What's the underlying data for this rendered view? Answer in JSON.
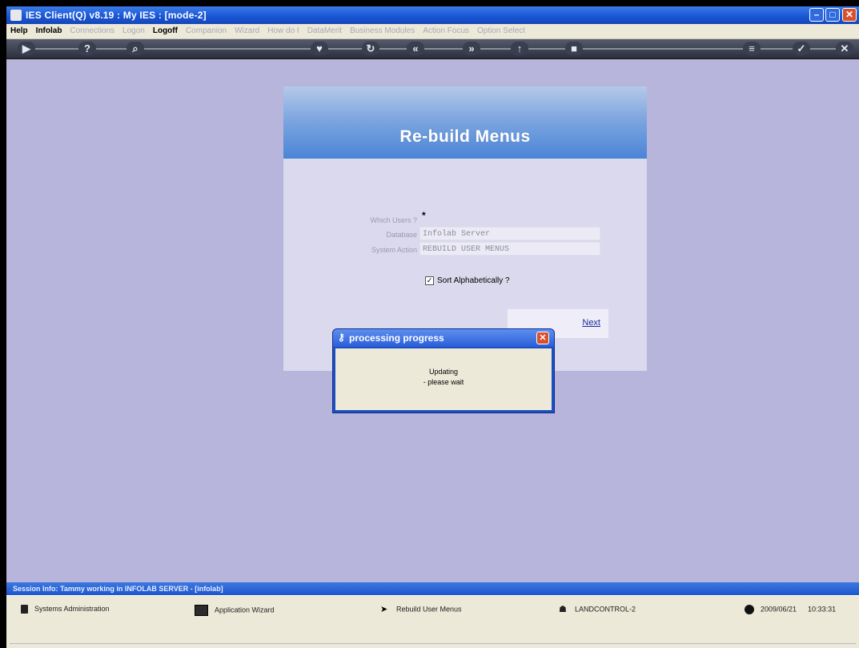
{
  "window": {
    "title": "IES Client(Q) v8.19 : My IES :        [mode-2]",
    "controls": {
      "minimize": "–",
      "maximize": "□",
      "close": "✕"
    }
  },
  "menu": {
    "items": [
      {
        "label": "Help",
        "state": "active"
      },
      {
        "label": "Infolab",
        "state": "active"
      },
      {
        "label": "Connections",
        "state": "dim"
      },
      {
        "label": "Logon",
        "state": "dim"
      },
      {
        "label": "Logoff",
        "state": "active"
      },
      {
        "label": "Companion",
        "state": "dim"
      },
      {
        "label": "Wizard",
        "state": "dim"
      },
      {
        "label": "How do I",
        "state": "dim"
      },
      {
        "label": "DataMerit",
        "state": "dim"
      },
      {
        "label": "Business Modules",
        "state": "dim"
      },
      {
        "label": "Action Focus",
        "state": "dim"
      },
      {
        "label": "Option Select",
        "state": "dim"
      }
    ]
  },
  "toolbar": {
    "buttons": [
      {
        "name": "back-icon",
        "glyph": "▶"
      },
      {
        "name": "help-icon",
        "glyph": "?"
      },
      {
        "name": "search-icon",
        "glyph": "⌕"
      },
      {
        "name": "heart-icon",
        "glyph": "♥"
      },
      {
        "name": "refresh-icon",
        "glyph": "↻"
      },
      {
        "name": "prev-icon",
        "glyph": "«"
      },
      {
        "name": "next-icon",
        "glyph": "»"
      },
      {
        "name": "up-icon",
        "glyph": "↑"
      },
      {
        "name": "stop-icon",
        "glyph": "■"
      },
      {
        "name": "menu-icon",
        "glyph": "≡"
      },
      {
        "name": "check-icon",
        "glyph": "✓"
      },
      {
        "name": "exit-icon",
        "glyph": "✕"
      }
    ]
  },
  "panel": {
    "title": "Re-build Menus",
    "fields": {
      "which_users_label": "Which Users ?",
      "which_users_value": "*",
      "database_label": "Database",
      "database_value": "Infolab Server",
      "system_action_label": "System Action",
      "system_action_value": "REBUILD USER MENUS"
    },
    "sort_label": "Sort Alphabetically ?",
    "sort_checked": true,
    "next_label": "Next"
  },
  "modal": {
    "title": "processing progress",
    "line1": "Updating",
    "line2": "- please wait"
  },
  "session": {
    "text": "Session Info: Tammy working in INFOLAB SERVER - [infolab]"
  },
  "statusbar": {
    "system_admin": "Systems Administration",
    "app_wizard": "Application Wizard",
    "rebuild": "Rebuild User Menus",
    "machine": "LANDCONTROL-2",
    "date": "2009/06/21",
    "time": "10:33:31"
  },
  "colors": {
    "background": "#b7b5dc",
    "title_bar": "#1a57d6",
    "panel_header": "#4a85d6",
    "link": "#1a2a9c"
  }
}
